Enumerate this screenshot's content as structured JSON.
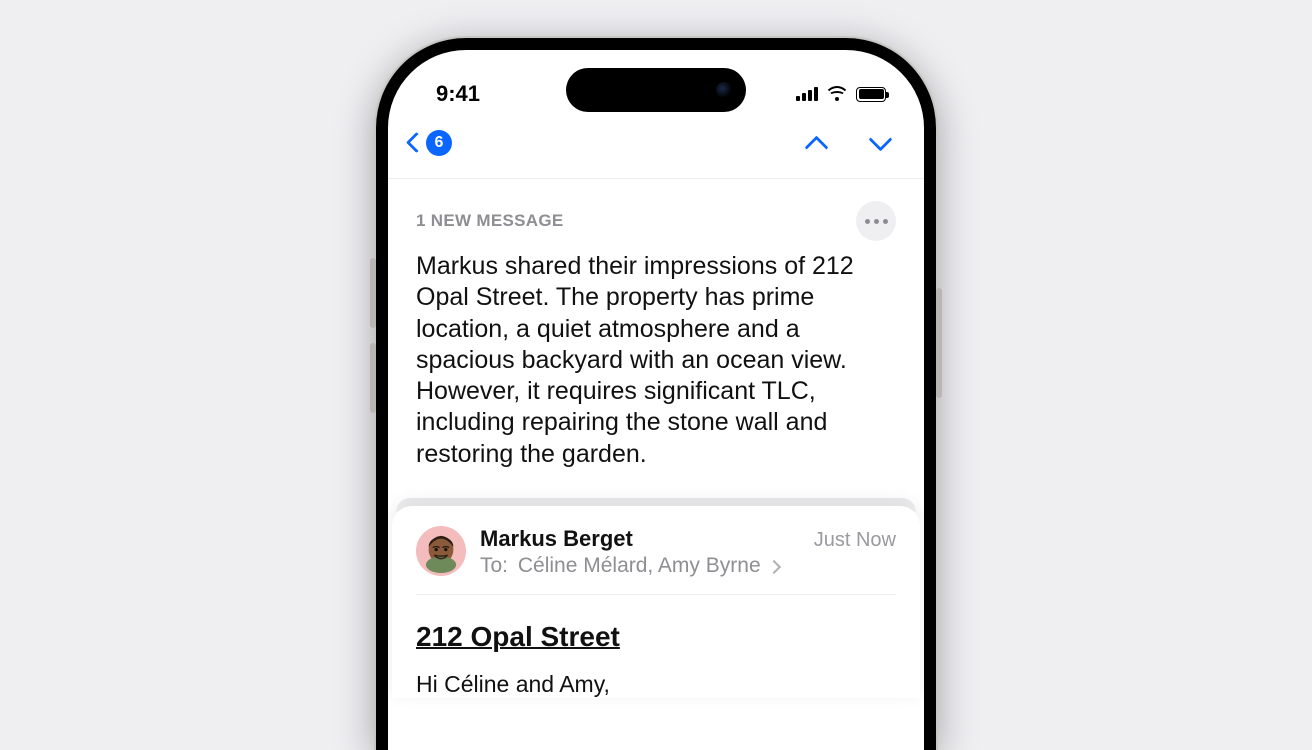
{
  "status": {
    "time": "9:41"
  },
  "nav": {
    "back_badge": "6"
  },
  "summary": {
    "label": "1 NEW MESSAGE",
    "text": "Markus shared their impressions of 212 Opal Street. The property has prime location, a quiet atmosphere and a spacious backyard with an ocean view. However, it requires significant TLC, including repairing the stone wall and restoring the garden."
  },
  "message": {
    "sender": "Markus Berget",
    "timestamp": "Just Now",
    "to_label": "To:",
    "to_names": "Céline Mélard, Amy Byrne",
    "subject": "212 Opal Street",
    "body_line1": "Hi Céline and Amy,"
  }
}
